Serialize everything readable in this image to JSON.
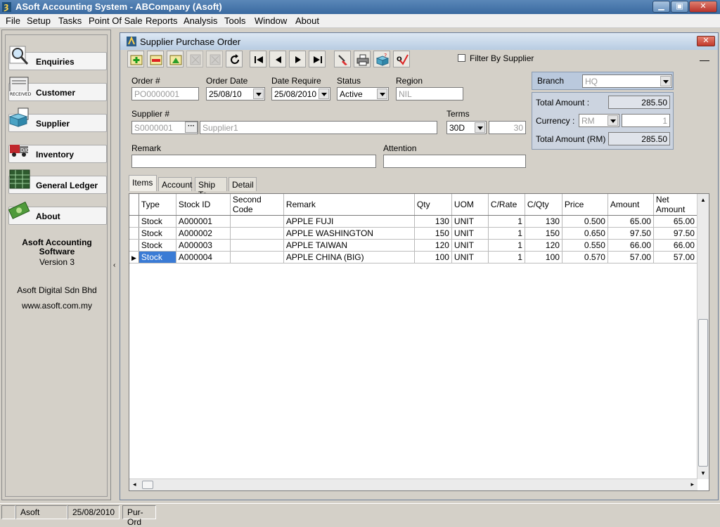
{
  "window": {
    "title": "ASoft Accounting System - ABCompany (Asoft)"
  },
  "menu": [
    "File",
    "Setup",
    "Tasks",
    "Point Of Sale",
    "Reports",
    "Analysis",
    "Tools",
    "Window",
    "About"
  ],
  "sidebar": {
    "items": [
      {
        "label": "Enquiries",
        "icon": "magnifier-icon"
      },
      {
        "label": "Customer",
        "icon": "received-doc-icon"
      },
      {
        "label": "Supplier",
        "icon": "invoice-box-icon"
      },
      {
        "label": "Inventory",
        "icon": "truck-icon"
      },
      {
        "label": "General Ledger",
        "icon": "ledger-grid-icon"
      },
      {
        "label": "About",
        "icon": "money-icon"
      }
    ],
    "about": {
      "product_line1": "Asoft Accounting",
      "product_line2": "Software",
      "version": "Version 3",
      "company": "Asoft Digital Sdn Bhd",
      "website": "www.asoft.com.my"
    }
  },
  "form": {
    "title": "Supplier Purchase Order",
    "filter_by_supplier_label": "Filter By Supplier",
    "order_no": {
      "label": "Order #",
      "value": "PO0000001"
    },
    "order_date": {
      "label": "Order Date",
      "value": "25/08/10"
    },
    "date_require": {
      "label": "Date Require",
      "value": "25/08/2010"
    },
    "status": {
      "label": "Status",
      "value": "Active"
    },
    "region": {
      "label": "Region",
      "value": "NIL"
    },
    "supplier_no": {
      "label": "Supplier #",
      "value": "S0000001",
      "name": "Supplier1"
    },
    "terms": {
      "label": "Terms",
      "value": "30D",
      "days": "30"
    },
    "remark": {
      "label": "Remark",
      "value": ""
    },
    "attention": {
      "label": "Attention",
      "value": ""
    },
    "branch": {
      "label": "Branch",
      "value": "HQ"
    },
    "total_amount": {
      "label": "Total Amount :",
      "value": "285.50"
    },
    "currency": {
      "label": "Currency :",
      "value": "RM",
      "rate": "1"
    },
    "total_amount_rm": {
      "label": "Total Amount (RM)",
      "value": "285.50"
    }
  },
  "tabs": [
    "Items",
    "Account",
    "Ship To",
    "Detail"
  ],
  "grid": {
    "columns": [
      "Type",
      "Stock ID",
      "Second Code",
      "Remark",
      "Qty",
      "UOM",
      "C/Rate",
      "C/Qty",
      "Price",
      "Amount",
      "Net Amount"
    ],
    "rows": [
      [
        "Stock",
        "A000001",
        "",
        "APPLE FUJI",
        "130",
        "UNIT",
        "1",
        "130",
        "0.500",
        "65.00",
        "65.00"
      ],
      [
        "Stock",
        "A000002",
        "",
        "APPLE WASHINGTON",
        "150",
        "UNIT",
        "1",
        "150",
        "0.650",
        "97.50",
        "97.50"
      ],
      [
        "Stock",
        "A000003",
        "",
        "APPLE TAIWAN",
        "120",
        "UNIT",
        "1",
        "120",
        "0.550",
        "66.00",
        "66.00"
      ],
      [
        "Stock",
        "A000004",
        "",
        "APPLE CHINA (BIG)",
        "100",
        "UNIT",
        "1",
        "100",
        "0.570",
        "57.00",
        "57.00"
      ]
    ]
  },
  "statusbar": {
    "user": "Asoft",
    "date": "25/08/2010",
    "module": "Pur-Ord"
  }
}
